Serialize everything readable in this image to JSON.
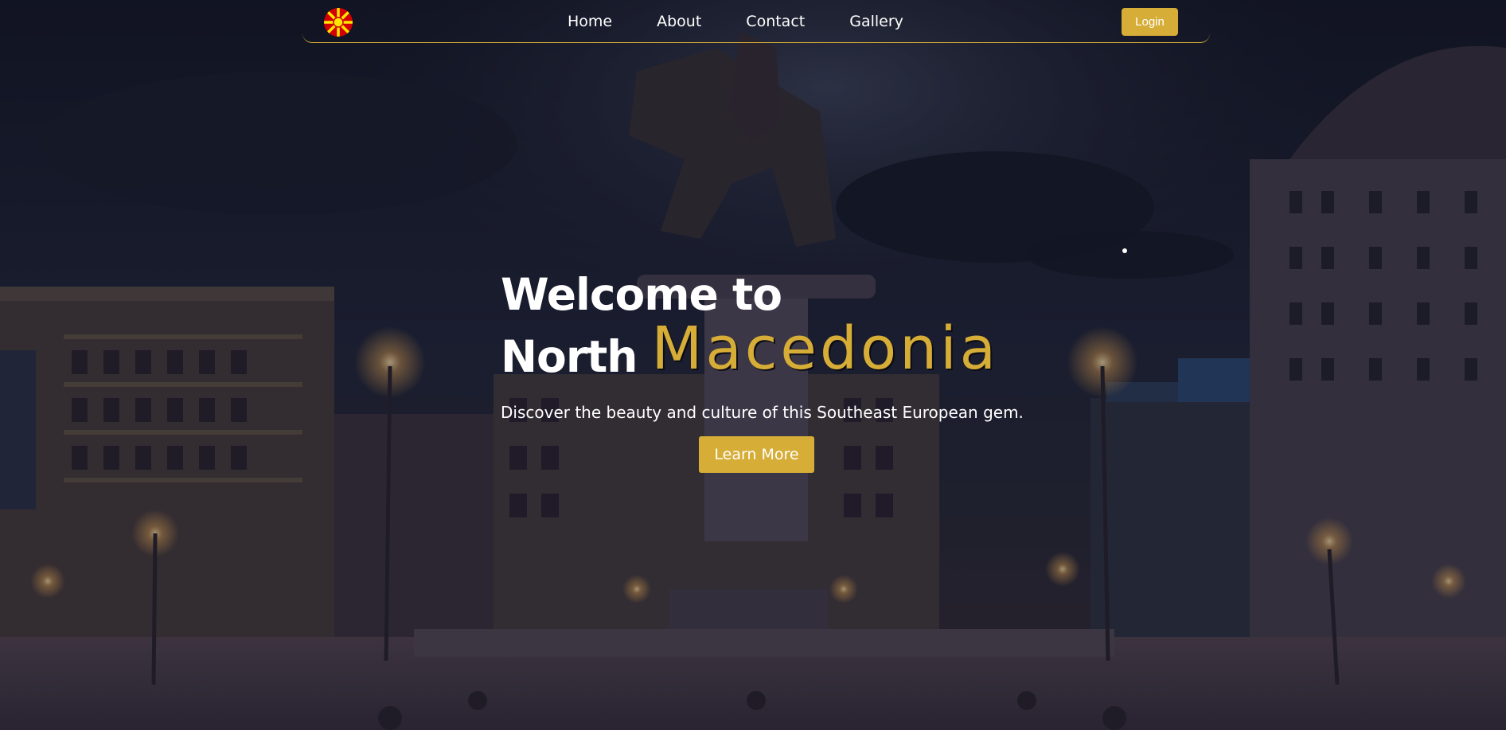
{
  "nav": {
    "logo": "north-macedonia-flag",
    "links": [
      "Home",
      "About",
      "Contact",
      "Gallery"
    ],
    "login_label": "Login"
  },
  "hero": {
    "title_line1": "Welcome to",
    "title_line2_plain": "North",
    "title_line2_accent": "Macedonia",
    "subtitle": "Discover the beauty and culture of this Southeast European gem.",
    "cta_label": "Learn More"
  },
  "colors": {
    "accent": "#d6ad36",
    "text": "#ffffff",
    "overlay": "#0c0f1e"
  }
}
